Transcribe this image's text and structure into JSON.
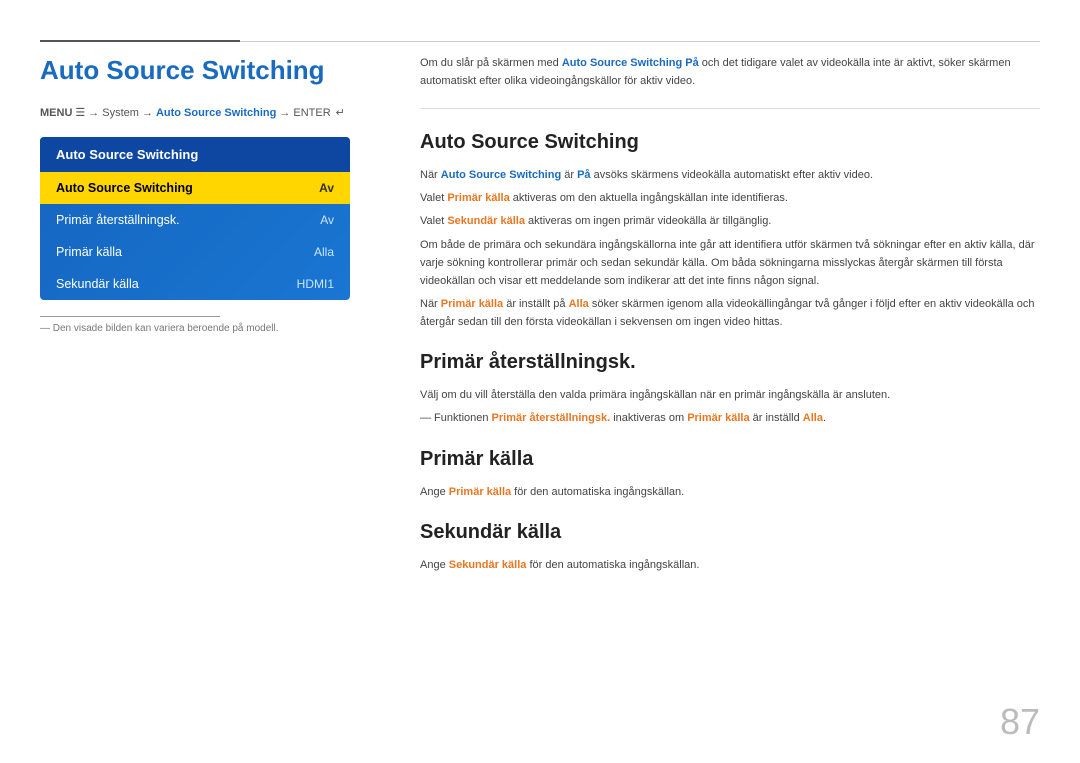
{
  "topline": {},
  "left": {
    "page_title": "Auto Source Switching",
    "breadcrumb": {
      "menu": "MENU",
      "system": "System",
      "link": "Auto Source Switching",
      "enter": "ENTER"
    },
    "tv_menu": {
      "header": "Auto Source Switching",
      "items": [
        {
          "label": "Auto Source Switching",
          "value": "Av",
          "selected": true
        },
        {
          "label": "Primär återställningsk.",
          "value": "Av",
          "selected": false
        },
        {
          "label": "Primär källa",
          "value": "Alla",
          "selected": false
        },
        {
          "label": "Sekundär källa",
          "value": "HDMI1",
          "selected": false
        }
      ]
    },
    "footnote": "― Den visade bilden kan variera beroende på modell."
  },
  "right": {
    "intro": "Om du slår på skärmen med Auto Source Switching På och det tidigare valet av videokälla inte är aktivt, söker skärmen automatiskt efter olika videoingångskällor för aktiv video.",
    "section1": {
      "title": "Auto Source Switching",
      "paragraphs": [
        "När Auto Source Switching är På avsöks skärmens videokälla automatiskt efter aktiv video.",
        "Valet Primär källa aktiveras om den aktuella ingångskällan inte identifieras.",
        "Valet Sekundär källa aktiveras om ingen primär videokälla är tillgänglig.",
        "Om både de primära och sekundära ingångskällorna inte går att identifiera utför skärmen två sökningar efter en aktiv källa, där varje sökning kontrollerar primär och sedan sekundär källa. Om båda sökningarna misslyckas återgår skärmen till första videokällan och visar ett meddelande som indikerar att det inte finns någon signal.",
        "När Primär källa är inställt på Alla söker skärmen igenom alla videokällingångar två gånger i följd efter en aktiv videokälla och återgår sedan till den första videokällan i sekvensen om ingen video hittas."
      ]
    },
    "section2": {
      "title": "Primär återställningsk.",
      "paragraphs": [
        "Välj om du vill återställa den valda primära ingångskällan när en primär ingångskälla är ansluten.",
        "― Funktionen Primär återställningsk. inaktiveras om Primär källa är inställd Alla."
      ]
    },
    "section3": {
      "title": "Primär källa",
      "paragraphs": [
        "Ange Primär källa för den automatiska ingångskällan."
      ]
    },
    "section4": {
      "title": "Sekundär källa",
      "paragraphs": [
        "Ange Sekundär källa för den automatiska ingångskällan."
      ]
    }
  },
  "page_number": "87"
}
